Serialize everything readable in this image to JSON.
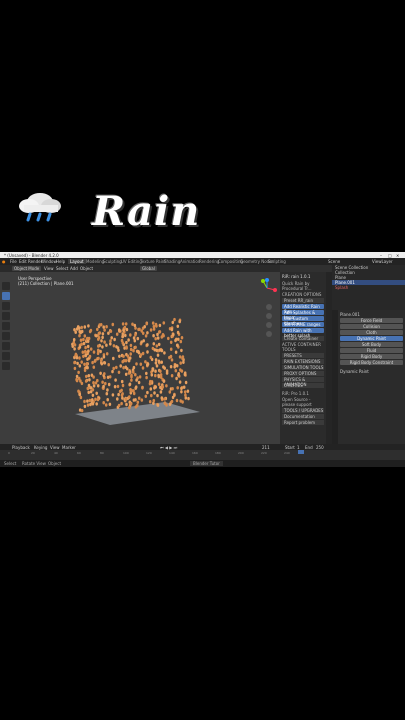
{
  "overlay": {
    "title": "Rain",
    "emoji": "cloud-with-rain-icon"
  },
  "window": {
    "title": "* (Unsaved) - Blender 4.2.0"
  },
  "menu": [
    "File",
    "Edit",
    "Render",
    "Window",
    "Help"
  ],
  "workspaces": [
    "Layout",
    "Modeling",
    "Sculpting",
    "UV Editing",
    "Texture Paint",
    "Shading",
    "Animation",
    "Rendering",
    "Compositing",
    "Geometry Nodes",
    "Scripting"
  ],
  "active_workspace": "Layout",
  "header": {
    "mode": "Object Mode",
    "view": "View",
    "select": "Select",
    "add": "Add",
    "object": "Object",
    "orientation": "Global"
  },
  "viewport": {
    "line1": "User Perspective",
    "line2": "(211) Collection | Plane.001"
  },
  "npanel": {
    "header": "RiR: rain 1.0.1",
    "subheader": "Quick Rain by Procedural Tr...",
    "section1": "CREATION OPTIONS",
    "preset_label": "Preset",
    "preset_value": "RR_rain",
    "buttons": [
      "Add Realistic Rain Sys...",
      "Add Splashes & Impa...",
      "Use Custom Weather",
      "Set FRAME ranges",
      "Add Rain with better splash"
    ],
    "actions": [
      "Create Container"
    ],
    "section2": "ACTIVE CONTAINER TOOLS",
    "tools": [
      "PRESETS",
      "RAIN EXTENSIONS",
      "SIMULATION TOOLS",
      "PROXY OPTIONS",
      "PHYSICS & ANIMATION",
      "UTILITIES"
    ],
    "section3": "RiR: Pro 1.0.1",
    "info": "Open Source - please support",
    "bottom": [
      "TOOLS / UPGRADES",
      "Documentation",
      "Report problem"
    ]
  },
  "outliner": {
    "rows": [
      "Scene Collection",
      "Collection",
      "Plane",
      "Plane.001",
      "Splash"
    ],
    "selected": 3,
    "view_layer": "ViewLayer",
    "scene": "Scene"
  },
  "properties": {
    "object_name": "Plane.001",
    "items": [
      "Force Field",
      "Collision",
      "Cloth",
      "Dynamic Paint",
      "Soft Body",
      "Fluid",
      "Rigid Body",
      "Rigid Body Constraint"
    ],
    "active_index": 3,
    "footer": "Dynamic Paint"
  },
  "timeline": {
    "menus": [
      "Playback",
      "Keying",
      "View",
      "Marker"
    ],
    "start_label": "Start",
    "start": "1",
    "end_label": "End",
    "end": "250",
    "current": "211",
    "ticks": [
      "0",
      "20",
      "40",
      "60",
      "80",
      "100",
      "120",
      "140",
      "160",
      "180",
      "200",
      "220",
      "240"
    ]
  },
  "status": {
    "select": "Select",
    "rotate": "Rotate View",
    "object": "Object",
    "center": "Blender Tutor"
  }
}
